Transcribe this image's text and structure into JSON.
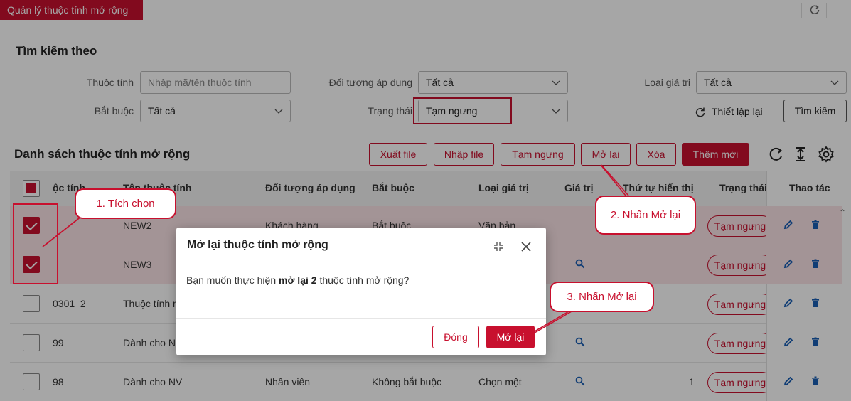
{
  "app": {
    "tab_title": "Quản lý thuộc tính mở rộng"
  },
  "search": {
    "title": "Tìm kiếm theo",
    "attr_label": "Thuộc tính",
    "attr_placeholder": "Nhập mã/tên thuộc tính",
    "target_label": "Đối tượng áp dụng",
    "target_value": "Tất cả",
    "valtype_label": "Loại giá trị",
    "valtype_value": "Tất cả",
    "required_label": "Bắt buộc",
    "required_value": "Tất cả",
    "status_label": "Trạng thái",
    "status_value": "Tạm ngưng",
    "reset_label": "Thiết lập lại",
    "search_label": "Tìm kiếm"
  },
  "list": {
    "title": "Danh sách thuộc tính mở rộng",
    "actions": [
      "Xuất file",
      "Nhập file",
      "Tạm ngưng",
      "Mở lại",
      "Xóa",
      "Thêm mới"
    ],
    "columns": [
      "ộc tính",
      "Tên thuộc tính",
      "Đối tượng áp dụng",
      "Bắt buộc",
      "Loại giá trị",
      "Giá trị",
      "Thứ tự hiển thị",
      "Trạng thái",
      "Thao tác"
    ],
    "rows": [
      {
        "code": "",
        "name": "NEW2",
        "target": "Khách hàng",
        "required": "Bắt buộc",
        "valtype": "Văn bản",
        "order": "",
        "status": "Tạm ngưng",
        "selected": true
      },
      {
        "code": "",
        "name": "NEW3",
        "target": "",
        "required": "",
        "valtype": "",
        "order": "",
        "status": "Tạm ngưng",
        "selected": true
      },
      {
        "code": "0301_2",
        "name": "Thuộc tính m",
        "target": "",
        "required": "",
        "valtype": "",
        "order": "",
        "status": "Tạm ngưng",
        "selected": false
      },
      {
        "code": "99",
        "name": "Dành cho NV",
        "target": "",
        "required": "",
        "valtype": "",
        "order": "",
        "status": "Tạm ngưng",
        "selected": false
      },
      {
        "code": "98",
        "name": "Dành cho NV",
        "target": "Nhân viên",
        "required": "Không bắt buộc",
        "valtype": "Chọn một",
        "order": "1",
        "status": "Tạm ngưng",
        "selected": false
      }
    ]
  },
  "modal": {
    "title": "Mở lại thuộc tính mở rộng",
    "body_prefix": "Bạn muốn thực hiện ",
    "body_bold": "mở lại 2",
    "body_suffix": " thuộc tính mở rộng?",
    "close_label": "Đóng",
    "confirm_label": "Mở lại"
  },
  "callouts": {
    "step1": "1. Tích chọn",
    "step2": "2. Nhấn Mở lại",
    "step3": "3. Nhấn Mở lại"
  },
  "colors": {
    "brand": "#c8102e"
  }
}
